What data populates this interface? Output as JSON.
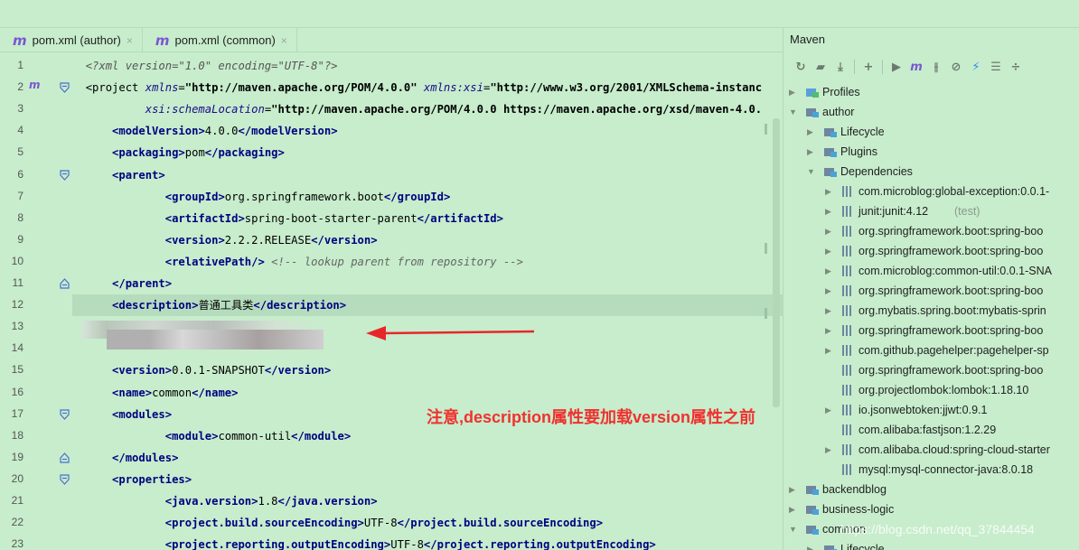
{
  "tabs": [
    {
      "icon": "m",
      "label": "pom.xml (author)",
      "close": "×"
    },
    {
      "icon": "m",
      "label": "pom.xml (common)",
      "close": "×"
    }
  ],
  "code_lines": [
    {
      "n": "1",
      "mark": "",
      "segs": [
        {
          "t": "pi",
          "v": "<?xml version=\"1.0\" encoding=\"UTF-8\"?>"
        }
      ]
    },
    {
      "n": "2",
      "mark": "m",
      "segs": [
        {
          "t": "txt",
          "v": "<project "
        },
        {
          "t": "attr",
          "v": "xmlns"
        },
        {
          "t": "txt",
          "v": "="
        },
        {
          "t": "val",
          "v": "\"http://maven.apache.org/POM/4.0.0\""
        },
        {
          "t": "txt",
          "v": " "
        },
        {
          "t": "attr",
          "v": "xmlns:xsi"
        },
        {
          "t": "txt",
          "v": "="
        },
        {
          "t": "val",
          "v": "\"http://www.w3.org/2001/XMLSchema-instanc"
        }
      ]
    },
    {
      "n": "3",
      "mark": "",
      "segs": [
        {
          "t": "txt",
          "v": "         "
        },
        {
          "t": "attr",
          "v": "xsi:schemaLocation"
        },
        {
          "t": "txt",
          "v": "="
        },
        {
          "t": "val",
          "v": "\"http://maven.apache.org/POM/4.0.0 https://maven.apache.org/xsd/maven-4.0."
        }
      ]
    },
    {
      "n": "4",
      "mark": "",
      "segs": [
        {
          "t": "tag",
          "v": "modelVersion"
        },
        {
          "t": "txt",
          "v": "4.0.0"
        },
        {
          "t": "ctag",
          "v": "modelVersion"
        }
      ]
    },
    {
      "n": "5",
      "mark": "",
      "segs": [
        {
          "t": "tag",
          "v": "packaging"
        },
        {
          "t": "txt",
          "v": "pom"
        },
        {
          "t": "ctag",
          "v": "packaging"
        }
      ]
    },
    {
      "n": "6",
      "mark": "",
      "segs": [
        {
          "t": "tag",
          "v": "parent"
        }
      ]
    },
    {
      "n": "7",
      "mark": "",
      "segs": [
        {
          "t": "txt",
          "v": "    "
        },
        {
          "t": "tag",
          "v": "groupId"
        },
        {
          "t": "txt",
          "v": "org.springframework.boot"
        },
        {
          "t": "ctag",
          "v": "groupId"
        }
      ]
    },
    {
      "n": "8",
      "mark": "",
      "segs": [
        {
          "t": "txt",
          "v": "    "
        },
        {
          "t": "tag",
          "v": "artifactId"
        },
        {
          "t": "txt",
          "v": "spring-boot-starter-parent"
        },
        {
          "t": "ctag",
          "v": "artifactId"
        }
      ]
    },
    {
      "n": "9",
      "mark": "",
      "segs": [
        {
          "t": "txt",
          "v": "    "
        },
        {
          "t": "tag",
          "v": "version"
        },
        {
          "t": "txt",
          "v": "2.2.2.RELEASE"
        },
        {
          "t": "ctag",
          "v": "version"
        }
      ]
    },
    {
      "n": "10",
      "mark": "",
      "segs": [
        {
          "t": "txt",
          "v": "    "
        },
        {
          "t": "tag",
          "v": "relativePath/"
        },
        {
          "t": "txt",
          "v": " "
        },
        {
          "t": "cmt",
          "v": "<!-- lookup parent from repository -->"
        }
      ]
    },
    {
      "n": "11",
      "mark": "",
      "segs": [
        {
          "t": "ctag",
          "v": "parent"
        }
      ]
    },
    {
      "n": "12",
      "mark": "",
      "segs": [
        {
          "t": "tag",
          "v": "description"
        },
        {
          "t": "txt",
          "v": "普通工具类"
        },
        {
          "t": "ctag",
          "v": "description"
        }
      ]
    },
    {
      "n": "13",
      "mark": "",
      "segs": []
    },
    {
      "n": "14",
      "mark": "",
      "segs": []
    },
    {
      "n": "15",
      "mark": "",
      "segs": [
        {
          "t": "tag",
          "v": "version"
        },
        {
          "t": "txt",
          "v": "0.0.1-SNAPSHOT"
        },
        {
          "t": "ctag",
          "v": "version"
        }
      ]
    },
    {
      "n": "16",
      "mark": "",
      "segs": [
        {
          "t": "tag",
          "v": "name"
        },
        {
          "t": "txt",
          "v": "common"
        },
        {
          "t": "ctag",
          "v": "name"
        }
      ]
    },
    {
      "n": "17",
      "mark": "",
      "segs": [
        {
          "t": "tag",
          "v": "modules"
        }
      ]
    },
    {
      "n": "18",
      "mark": "",
      "segs": [
        {
          "t": "txt",
          "v": "    "
        },
        {
          "t": "tag",
          "v": "module"
        },
        {
          "t": "txt",
          "v": "common-util"
        },
        {
          "t": "ctag",
          "v": "module"
        }
      ]
    },
    {
      "n": "19",
      "mark": "",
      "segs": [
        {
          "t": "ctag",
          "v": "modules"
        }
      ]
    },
    {
      "n": "20",
      "mark": "",
      "segs": [
        {
          "t": "tag",
          "v": "properties"
        }
      ]
    },
    {
      "n": "21",
      "mark": "",
      "segs": [
        {
          "t": "txt",
          "v": "    "
        },
        {
          "t": "tag",
          "v": "java.version"
        },
        {
          "t": "txt",
          "v": "1.8"
        },
        {
          "t": "ctag",
          "v": "java.version"
        }
      ]
    },
    {
      "n": "22",
      "mark": "",
      "segs": [
        {
          "t": "txt",
          "v": "    "
        },
        {
          "t": "tag",
          "v": "project.build.sourceEncoding"
        },
        {
          "t": "txt",
          "v": "UTF-8"
        },
        {
          "t": "ctag",
          "v": "project.build.sourceEncoding"
        }
      ]
    },
    {
      "n": "23",
      "mark": "",
      "segs": [
        {
          "t": "txt",
          "v": "    "
        },
        {
          "t": "tag",
          "v": "project.reporting.outputEncoding"
        },
        {
          "t": "txt",
          "v": "UTF-8"
        },
        {
          "t": "ctag",
          "v": "project.reporting.outputEncoding"
        }
      ]
    }
  ],
  "annotation": "注意,description属性要加载version属性之前",
  "maven": {
    "title": "Maven",
    "toolbar": [
      "refresh-icon",
      "reimport-icon",
      "download-icon",
      "add-icon",
      "run-icon",
      "execute-goal-icon",
      "toggle-offline-icon",
      "skip-tests-icon",
      "lightning-icon",
      "collapse-all-icon",
      "settings-icon"
    ],
    "tree": [
      {
        "depth": 0,
        "arrow": "▶",
        "icon": "profiles-icon",
        "label": "Profiles"
      },
      {
        "depth": 0,
        "arrow": "▼",
        "icon": "module-icon",
        "label": "author"
      },
      {
        "depth": 1,
        "arrow": "▶",
        "icon": "lifecycle-icon",
        "label": "Lifecycle"
      },
      {
        "depth": 1,
        "arrow": "▶",
        "icon": "plugins-icon",
        "label": "Plugins"
      },
      {
        "depth": 1,
        "arrow": "▼",
        "icon": "dependencies-icon",
        "label": "Dependencies"
      },
      {
        "depth": 2,
        "arrow": "▶",
        "icon": "library-icon",
        "label": "com.microblog:global-exception:0.0.1-"
      },
      {
        "depth": 2,
        "arrow": "▶",
        "icon": "library-icon",
        "label": "junit:junit:4.12",
        "suffix": " (test)"
      },
      {
        "depth": 2,
        "arrow": "▶",
        "icon": "library-icon",
        "label": "org.springframework.boot:spring-boo"
      },
      {
        "depth": 2,
        "arrow": "▶",
        "icon": "library-icon",
        "label": "org.springframework.boot:spring-boo"
      },
      {
        "depth": 2,
        "arrow": "▶",
        "icon": "library-icon",
        "label": "com.microblog:common-util:0.0.1-SNA"
      },
      {
        "depth": 2,
        "arrow": "▶",
        "icon": "library-icon",
        "label": "org.springframework.boot:spring-boo"
      },
      {
        "depth": 2,
        "arrow": "▶",
        "icon": "library-icon",
        "label": "org.mybatis.spring.boot:mybatis-sprin"
      },
      {
        "depth": 2,
        "arrow": "▶",
        "icon": "library-icon",
        "label": "org.springframework.boot:spring-boo"
      },
      {
        "depth": 2,
        "arrow": "▶",
        "icon": "library-icon",
        "label": "com.github.pagehelper:pagehelper-sp"
      },
      {
        "depth": 2,
        "arrow": "",
        "icon": "library-icon",
        "label": "org.springframework.boot:spring-boo"
      },
      {
        "depth": 2,
        "arrow": "",
        "icon": "library-icon",
        "label": "org.projectlombok:lombok:1.18.10"
      },
      {
        "depth": 2,
        "arrow": "▶",
        "icon": "library-icon",
        "label": "io.jsonwebtoken:jjwt:0.9.1"
      },
      {
        "depth": 2,
        "arrow": "",
        "icon": "library-icon",
        "label": "com.alibaba:fastjson:1.2.29"
      },
      {
        "depth": 2,
        "arrow": "▶",
        "icon": "library-icon",
        "label": "com.alibaba.cloud:spring-cloud-starter"
      },
      {
        "depth": 2,
        "arrow": "",
        "icon": "library-icon",
        "label": "mysql:mysql-connector-java:8.0.18"
      },
      {
        "depth": 0,
        "arrow": "▶",
        "icon": "module-icon",
        "label": "backendblog"
      },
      {
        "depth": 0,
        "arrow": "▶",
        "icon": "module-icon",
        "label": "business-logic"
      },
      {
        "depth": 0,
        "arrow": "▼",
        "icon": "module-icon",
        "label": "common"
      },
      {
        "depth": 1,
        "arrow": "▶",
        "icon": "lifecycle-icon",
        "label": "Lifecycle"
      }
    ]
  },
  "watermark": "https://blog.csdn.net/qq_37844454",
  "colors": {
    "background": "#c7edcc",
    "tag": "#000080",
    "annotation": "#f0312f",
    "arrow": "#e8262a",
    "maven_purple": "#7a57d1"
  }
}
